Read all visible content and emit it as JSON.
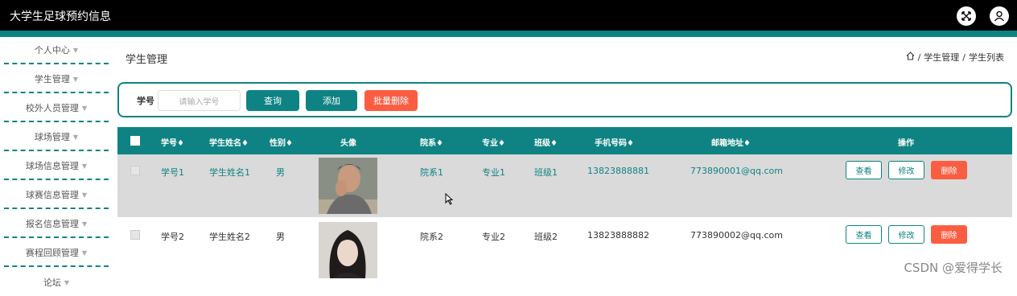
{
  "app": {
    "title": "大学生足球预约信息"
  },
  "icons": {
    "fullscreen": "fullscreen-icon",
    "user": "user-icon",
    "home": "home-icon"
  },
  "sidebar": {
    "items": [
      {
        "label": "个人中心"
      },
      {
        "label": "学生管理"
      },
      {
        "label": "校外人员管理"
      },
      {
        "label": "球场管理"
      },
      {
        "label": "球场信息管理"
      },
      {
        "label": "球赛信息管理"
      },
      {
        "label": "报名信息管理"
      },
      {
        "label": "赛程回顾管理"
      },
      {
        "label": "论坛"
      }
    ]
  },
  "page": {
    "title": "学生管理"
  },
  "breadcrumb": {
    "sep": "/",
    "level1": "学生管理",
    "level2": "学生列表"
  },
  "search": {
    "label": "学号",
    "placeholder": "请输入学号",
    "query_btn": "查询",
    "add_btn": "添加",
    "batch_delete_btn": "批量删除"
  },
  "table": {
    "headers": {
      "student_id": "学号♦",
      "student_name": "学生姓名♦",
      "gender": "性别♦",
      "avatar": "头像",
      "department": "院系♦",
      "major": "专业♦",
      "class_name": "班级♦",
      "phone": "手机号码♦",
      "email": "邮箱地址♦",
      "actions": "操作"
    },
    "rows": [
      {
        "student_id": "学号1",
        "student_name": "学生姓名1",
        "gender": "男",
        "department": "院系1",
        "major": "专业1",
        "class_name": "班级1",
        "phone": "13823888881",
        "email": "773890001@qq.com"
      },
      {
        "student_id": "学号2",
        "student_name": "学生姓名2",
        "gender": "男",
        "department": "院系2",
        "major": "专业2",
        "class_name": "班级2",
        "phone": "13823888882",
        "email": "773890002@qq.com"
      }
    ],
    "actions": {
      "view": "查看",
      "edit": "修改",
      "delete": "删除"
    }
  },
  "watermark": "CSDN @爱得学长",
  "colors": {
    "accent": "#0f8383",
    "danger": "#fb5d42",
    "topbar": "#000000",
    "row_hover": "#dadada"
  }
}
